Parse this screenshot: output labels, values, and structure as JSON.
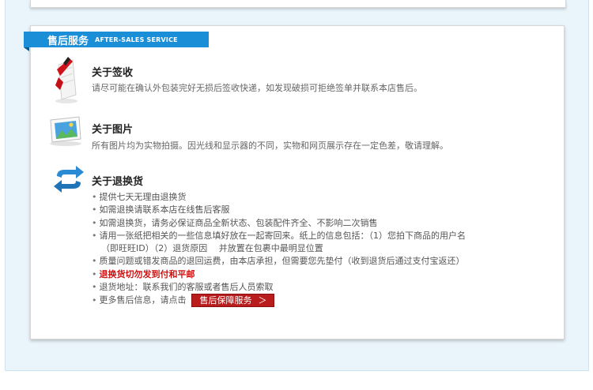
{
  "banner": {
    "title_cn": "售后服务",
    "title_en": "AFTER-SALES SERVICE"
  },
  "sections": [
    {
      "title": "关于签收",
      "icon": "signature-document-icon",
      "desc": "请尽可能在确认外包装完好无损后签收快递，如发现破损可拒绝签单并联系本店售后。"
    },
    {
      "title": "关于图片",
      "icon": "picture-frame-icon",
      "desc": "所有图片均为实物拍摄。因光线和显示器的不同，实物和网页展示存在一定色差，敬请理解。"
    },
    {
      "title": "关于退换货",
      "icon": "exchange-arrows-icon"
    }
  ],
  "returns_list": [
    "提供七天无理由退换货",
    "如需退换请联系本店在线售后客服",
    "如需退换货，请务必保证商品全新状态、包装配件齐全、不影响二次销售",
    "请用一张纸把相关的一些信息填好放在一起寄回来。纸上的信息包括：（1）您拍下商品的用户名",
    "（即旺旺ID）（2）退货原因　 并放置在包裹中最明显位置",
    "质量问题或错发商品的退回运费，由本店承担，但需要您先垫付（收到退货后通过支付宝返还）",
    "退换货切勿发到付和平邮",
    "退货地址：联系我们的客服或者售后人员索取",
    "更多售后信息，请点击"
  ],
  "service_button": {
    "label": "售后保障服务",
    "arrow": "＞"
  },
  "colors": {
    "banner": "#1a8ed6",
    "warning_text": "#cc1111",
    "button": "#b81c1c",
    "background": "#eaf5fb"
  }
}
